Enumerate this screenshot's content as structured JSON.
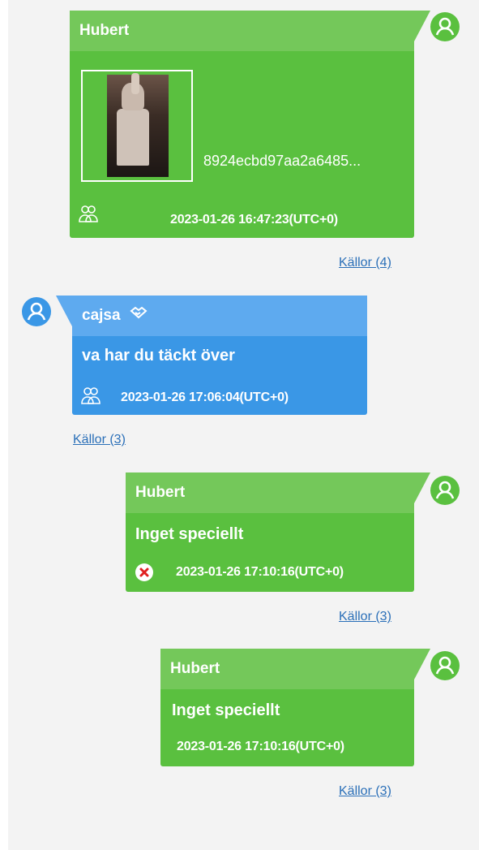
{
  "messages": [
    {
      "sender": "Hubert",
      "attachment_name": "8924ecbd97aa2a6485...",
      "timestamp": "2023-01-26 16:47:23(UTC+0)",
      "status_icon": "group-icon",
      "sources_link": "Källor (4)"
    },
    {
      "sender": "cajsa",
      "sender_badge_icon": "handshake-icon",
      "text": "va har du täckt över",
      "timestamp": "2023-01-26 17:06:04(UTC+0)",
      "status_icon": "group-icon",
      "sources_link": "Källor (3)"
    },
    {
      "sender": "Hubert",
      "text": "Inget speciellt",
      "timestamp": "2023-01-26 17:10:16(UTC+0)",
      "status_icon": "error-icon",
      "sources_link": "Källor (3)"
    },
    {
      "sender": "Hubert",
      "text": "Inget speciellt",
      "timestamp": "2023-01-26 17:10:16(UTC+0)",
      "sources_link": "Källor (3)"
    }
  ],
  "colors": {
    "outgoing": "#5ac03f",
    "outgoing_header": "#74c85a",
    "incoming": "#3a97e6",
    "incoming_header": "#5eaaef",
    "avatar": "#5ac03f",
    "avatar_incoming": "#3a97e6",
    "link": "#2a6fb8",
    "error": "#e02020"
  }
}
